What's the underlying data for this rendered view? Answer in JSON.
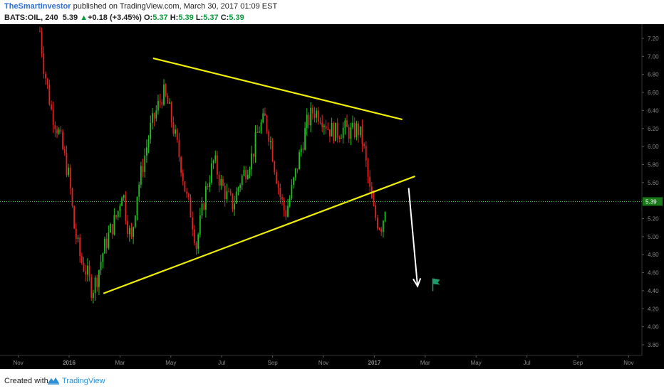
{
  "header": {
    "author": "TheSmartInvestor",
    "published_text": " published on TradingView.com, March 30, 2017 01:09 EST",
    "symbol": "BATS:OIL, 240",
    "last": "5.39",
    "arrow": "▲",
    "change": "+0.18 (+3.45%)",
    "o_label": "O:",
    "o_value": "5.37",
    "h_label": "H:",
    "h_value": "5.39",
    "l_label": "L:",
    "l_value": "5.37",
    "c_label": "C:",
    "c_value": "5.39"
  },
  "footer": {
    "created_with": "Created with",
    "brand": "TradingView",
    "logo_icon": "tradingview-logo-icon"
  },
  "colors": {
    "background": "#000000",
    "up": "#1fc21f",
    "down": "#e02222",
    "trendline": "#f0f000",
    "arrow": "#ffffff",
    "price_line": "#3fbf3f",
    "flag": "#1f9a6a"
  },
  "chart_data": {
    "type": "candlestick",
    "y_ticks": [
      "7.20",
      "7.00",
      "6.80",
      "6.60",
      "6.40",
      "6.20",
      "6.00",
      "5.80",
      "5.60",
      "5.40",
      "5.20",
      "5.00",
      "4.80",
      "4.60",
      "4.40",
      "4.20",
      "4.00",
      "3.80"
    ],
    "x_ticks": [
      "Nov",
      "2016",
      "Mar",
      "May",
      "Jul",
      "Sep",
      "Nov",
      "2017",
      "Mar",
      "May",
      "Jul",
      "Sep",
      "Nov"
    ],
    "x_ticks_bold": [
      "2016",
      "2017"
    ],
    "last_price_label": "5.39",
    "last_price": 5.39,
    "ylim": [
      3.6,
      7.3
    ],
    "xlim_months": [
      -2.3,
      23.4
    ],
    "price_path": [
      [
        -1.15,
        7.28
      ],
      [
        -1.0,
        6.9
      ],
      [
        -0.7,
        6.4
      ],
      [
        -0.4,
        6.15
      ],
      [
        0.0,
        5.65
      ],
      [
        0.2,
        5.1
      ],
      [
        0.45,
        4.75
      ],
      [
        0.7,
        4.6
      ],
      [
        0.9,
        4.4
      ],
      [
        1.1,
        4.55
      ],
      [
        1.35,
        4.85
      ],
      [
        1.6,
        5.05
      ],
      [
        1.9,
        5.25
      ],
      [
        2.1,
        5.55
      ],
      [
        2.25,
        5.2
      ],
      [
        2.45,
        4.95
      ],
      [
        2.65,
        5.45
      ],
      [
        2.9,
        5.8
      ],
      [
        3.2,
        6.2
      ],
      [
        3.5,
        6.45
      ],
      [
        3.7,
        6.6
      ],
      [
        3.9,
        6.45
      ],
      [
        4.1,
        6.2
      ],
      [
        4.4,
        5.8
      ],
      [
        4.6,
        5.45
      ],
      [
        4.8,
        5.25
      ],
      [
        5.0,
        4.9
      ],
      [
        5.15,
        5.15
      ],
      [
        5.4,
        5.55
      ],
      [
        5.7,
        5.85
      ],
      [
        5.95,
        5.6
      ],
      [
        6.2,
        5.45
      ],
      [
        6.45,
        5.35
      ],
      [
        6.7,
        5.6
      ],
      [
        6.95,
        5.75
      ],
      [
        7.2,
        5.9
      ],
      [
        7.45,
        6.2
      ],
      [
        7.7,
        6.3
      ],
      [
        7.9,
        6.1
      ],
      [
        8.1,
        5.75
      ],
      [
        8.3,
        5.45
      ],
      [
        8.5,
        5.25
      ],
      [
        8.7,
        5.45
      ],
      [
        8.9,
        5.7
      ],
      [
        9.1,
        5.95
      ],
      [
        9.35,
        6.25
      ],
      [
        9.6,
        6.4
      ],
      [
        9.9,
        6.35
      ],
      [
        10.2,
        6.2
      ],
      [
        10.5,
        6.15
      ],
      [
        10.8,
        6.2
      ],
      [
        11.1,
        6.15
      ],
      [
        11.35,
        6.2
      ],
      [
        11.55,
        6.05
      ],
      [
        11.7,
        5.75
      ],
      [
        11.85,
        5.45
      ],
      [
        12.0,
        5.25
      ],
      [
        12.15,
        5.15
      ],
      [
        12.3,
        5.12
      ],
      [
        12.45,
        5.39
      ]
    ],
    "trendlines": [
      {
        "name": "upper",
        "from": [
          3.3,
          6.98
        ],
        "to": [
          13.1,
          6.3
        ]
      },
      {
        "name": "lower",
        "from": [
          1.35,
          4.37
        ],
        "to": [
          13.6,
          5.67
        ]
      }
    ],
    "projection_arrow": {
      "from": [
        13.35,
        5.54
      ],
      "to": [
        13.7,
        4.45
      ]
    },
    "flag_marker": {
      "x": 14.3,
      "y": 4.49
    }
  }
}
